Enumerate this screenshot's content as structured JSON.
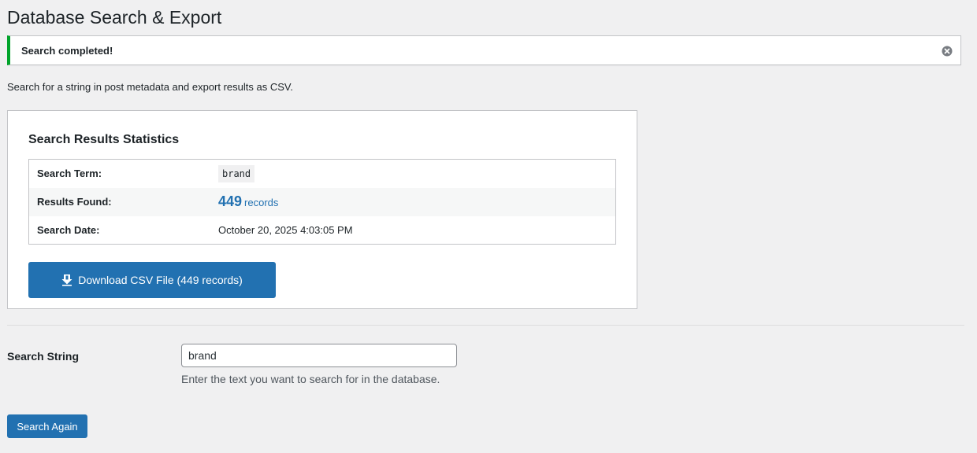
{
  "page": {
    "title": "Database Search & Export",
    "description": "Search for a string in post metadata and export results as CSV."
  },
  "notice": {
    "text": "Search completed!",
    "status_color": "#00a32a",
    "dismiss_icon": "dismiss-circle-icon"
  },
  "stats": {
    "title": "Search Results Statistics",
    "rows": [
      {
        "label": "Search Term:",
        "value": "brand"
      },
      {
        "label": "Results Found:",
        "count": "449",
        "unit": "records"
      },
      {
        "label": "Search Date:",
        "value": "October 20, 2025 4:03:05 PM"
      }
    ],
    "download_label": "Download CSV File (449 records)",
    "download_icon": "download-icon",
    "accent_color": "#2271b1"
  },
  "form": {
    "label": "Search String",
    "value": "brand",
    "help": "Enter the text you want to search for in the database.",
    "submit_label": "Search Again"
  }
}
